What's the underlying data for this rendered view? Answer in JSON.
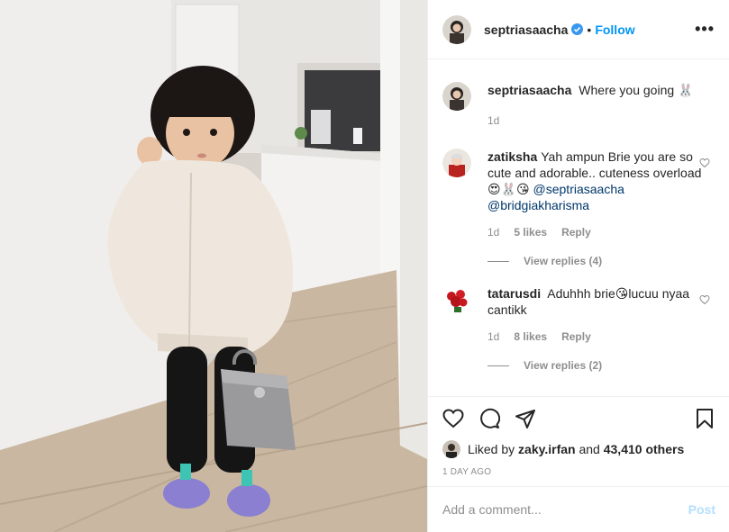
{
  "post": {
    "author": "septriasaacha",
    "follow_label": "Follow",
    "separator": "•",
    "more_label": "•••"
  },
  "caption": {
    "username": "septriasaacha",
    "text": "Where you going 🐰",
    "time": "1d"
  },
  "comments": [
    {
      "username": "zatiksha",
      "text": "Yah ampun Brie you are so cute and adorable.. cuteness overload 😍🐰😘 ",
      "mention1": "@septriasaacha",
      "mention2": "@bridgiakharisma",
      "time": "1d",
      "likes": "5 likes",
      "reply_label": "Reply",
      "view_replies": "View replies (4)"
    },
    {
      "username": "tatarusdi",
      "text": "Aduhhh brie😘lucuu nyaa cantikk",
      "time": "1d",
      "likes": "8 likes",
      "reply_label": "Reply",
      "view_replies": "View replies (2)"
    }
  ],
  "likes": {
    "prefix": "Liked by",
    "user": "zaky.irfan",
    "joiner": "and",
    "others": "43,410 others"
  },
  "date": "1 DAY AGO",
  "add_comment": {
    "placeholder": "Add a comment...",
    "post_label": "Post"
  },
  "icons": {
    "verified": "verified-badge-icon",
    "more": "more-options-icon",
    "like": "heart-icon",
    "comment": "comment-bubble-icon",
    "share": "paper-plane-icon",
    "save": "bookmark-icon"
  },
  "colors": {
    "link_blue": "#0095f6",
    "post_disabled": "#b2dffc",
    "muted": "#8e8e8e",
    "mention": "#00376b"
  }
}
